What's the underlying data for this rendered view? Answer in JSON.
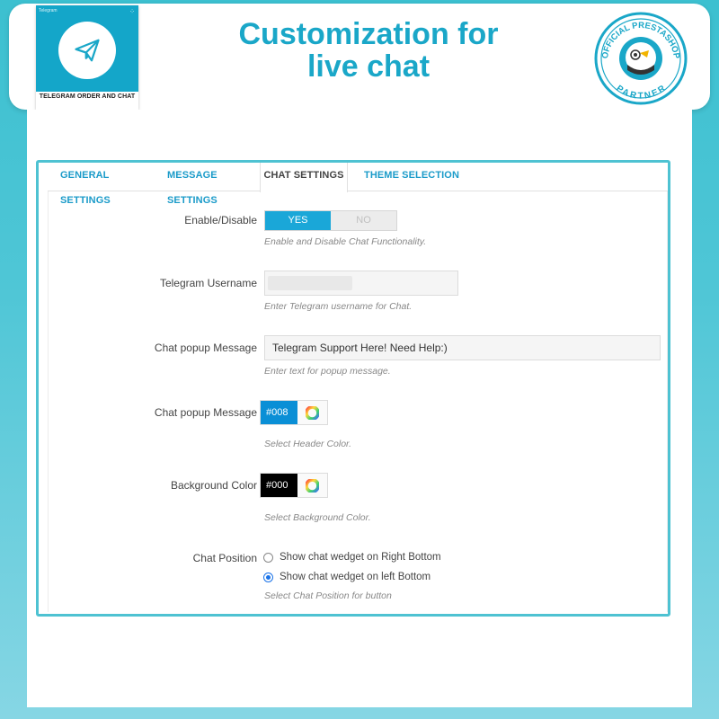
{
  "banner": {
    "headline_line1": "Customization for",
    "headline_line2": "live chat",
    "logo": {
      "caption": "TELEGRAM ORDER AND CHAT",
      "icon": "paper-plane-icon",
      "mini_text": "Telegram",
      "color": "#14a6c9"
    },
    "partner_badge": {
      "text_top": "OFFICIAL PRESTASHOP",
      "text_bottom": "PARTNER",
      "color": "#1aa7c8"
    }
  },
  "tabs": [
    {
      "label": "GENERAL SETTINGS",
      "active": false
    },
    {
      "label": "MESSAGE SETTINGS",
      "active": false
    },
    {
      "label": "CHAT SETTINGS",
      "active": true
    },
    {
      "label": "THEME SELECTION",
      "active": false
    }
  ],
  "form": {
    "enable": {
      "label": "Enable/Disable",
      "yes": "YES",
      "no": "NO",
      "selected": "YES",
      "help": "Enable and Disable Chat Functionality."
    },
    "username": {
      "label": "Telegram Username",
      "value": "",
      "help": "Enter Telegram username for Chat."
    },
    "popup_message": {
      "label": "Chat popup Message",
      "value": "Telegram Support Here! Need Help:)",
      "help": "Enter text for popup message."
    },
    "header_color": {
      "label": "Chat popup Message",
      "value": "#008",
      "swatch": "#0a8fd6",
      "help": "Select Header Color."
    },
    "background_color": {
      "label": "Background Color",
      "value": "#000",
      "swatch": "#000000",
      "help": "Select Background Color."
    },
    "position": {
      "label": "Chat Position",
      "options": [
        {
          "label": "Show chat wedget on Right Bottom",
          "checked": false
        },
        {
          "label": "Show chat wedget on left Bottom",
          "checked": true
        }
      ],
      "help": "Select Chat Position for button"
    }
  },
  "colors": {
    "accent": "#1aa7d8",
    "panel_border": "#4ec2d2",
    "tab_text": "#1b9bc9"
  }
}
